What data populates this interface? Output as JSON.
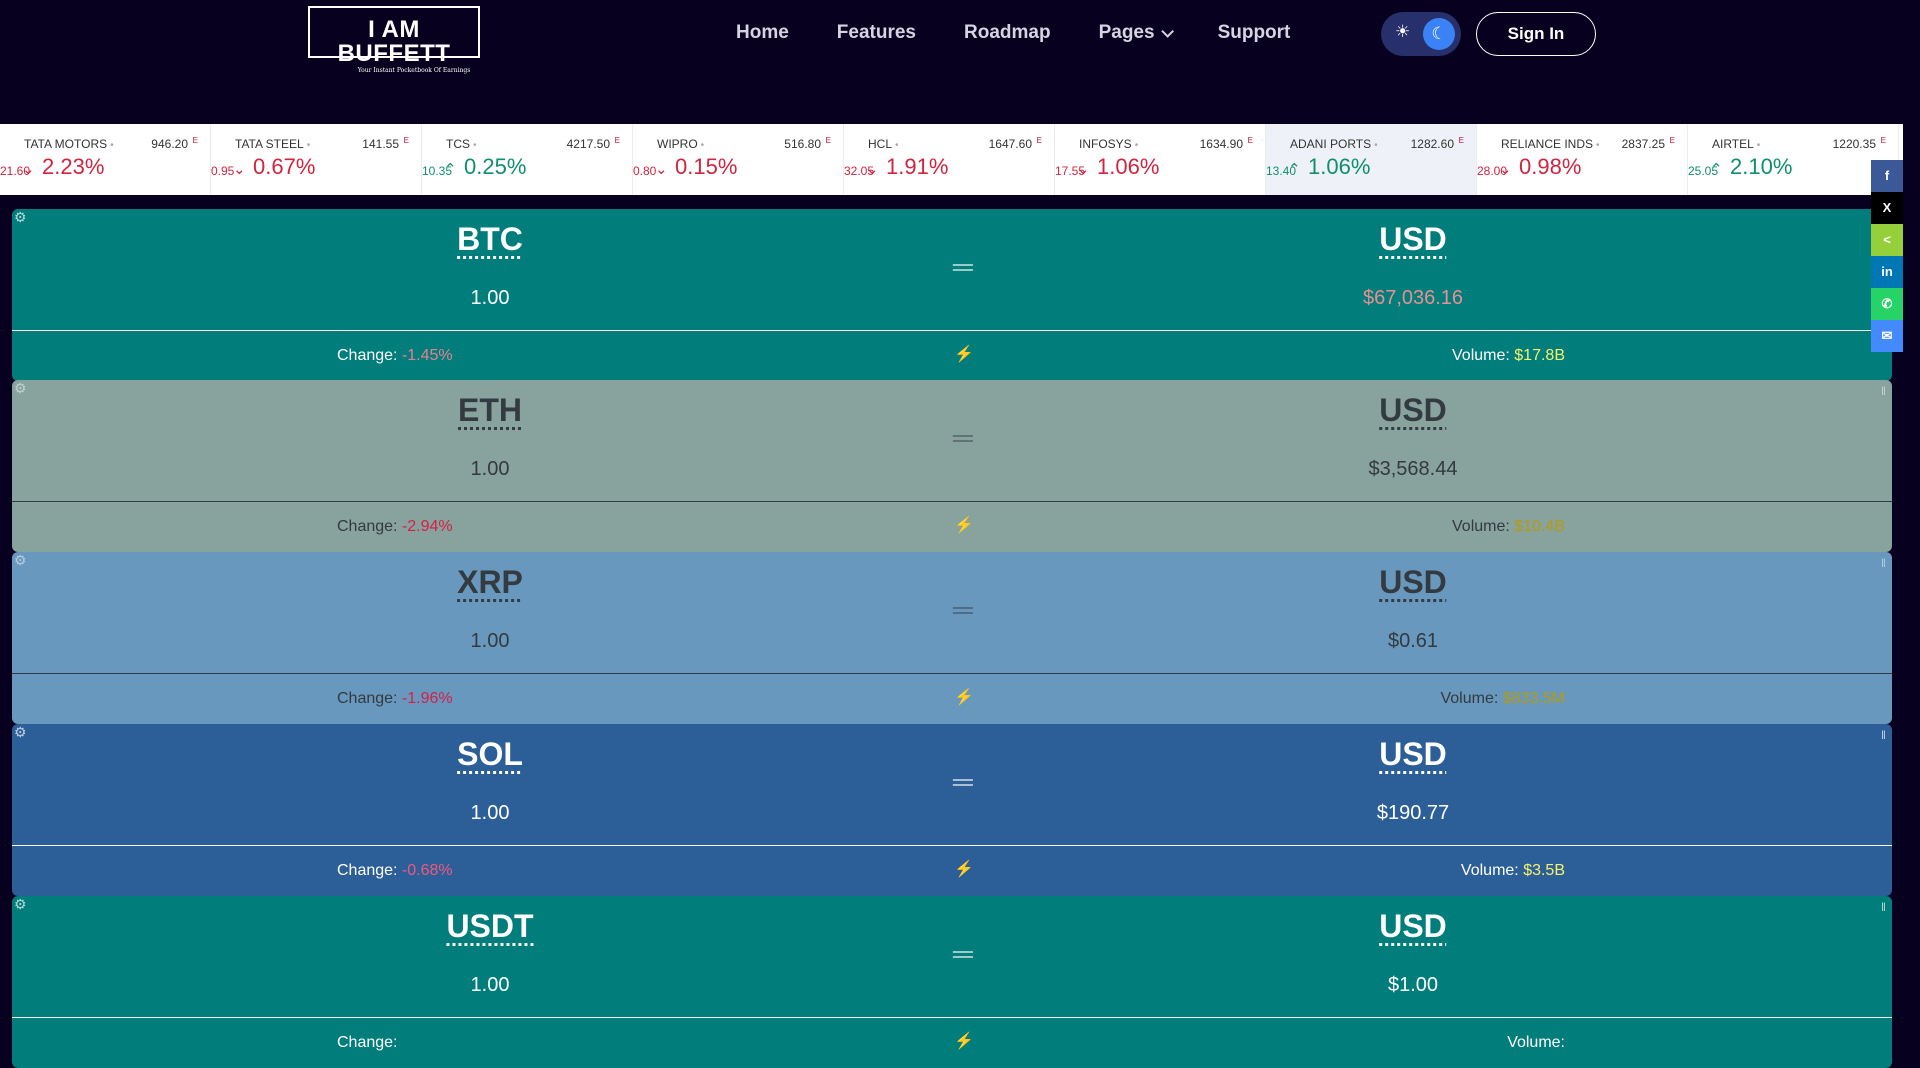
{
  "header": {
    "logo_title": "I AM BUFFETT",
    "logo_tagline": "Your Instant Pocketbook Of Earnings",
    "nav": [
      {
        "label": "Home"
      },
      {
        "label": "Features"
      },
      {
        "label": "Roadmap"
      },
      {
        "label": "Pages"
      },
      {
        "label": "Support"
      }
    ],
    "sign_in_label": "Sign In",
    "theme_sun": "☀",
    "theme_moon": "☾"
  },
  "ticker": [
    {
      "name": "TATA MOTORS",
      "price": "946.20",
      "marker": "E",
      "dir": "down",
      "arrow": "⌄",
      "pct": "2.23%",
      "chg": "21.60",
      "color": "#d0243f"
    },
    {
      "name": "TATA STEEL",
      "price": "141.55",
      "marker": "E",
      "dir": "down",
      "arrow": "⌄",
      "pct": "0.67%",
      "chg": "0.95",
      "color": "#d0243f"
    },
    {
      "name": "TCS",
      "price": "4217.50",
      "marker": "E",
      "dir": "up",
      "arrow": "⌃",
      "pct": "0.25%",
      "chg": "10.35",
      "color": "#0f8f6f"
    },
    {
      "name": "WIPRO",
      "price": "516.80",
      "marker": "E",
      "dir": "down",
      "arrow": "⌄",
      "pct": "0.15%",
      "chg": "0.80",
      "color": "#d0243f"
    },
    {
      "name": "HCL",
      "price": "1647.60",
      "marker": "E",
      "dir": "down",
      "arrow": "⌄",
      "pct": "1.91%",
      "chg": "32.05",
      "color": "#d0243f"
    },
    {
      "name": "INFOSYS",
      "price": "1634.90",
      "marker": "E",
      "dir": "down",
      "arrow": "⌄",
      "pct": "1.06%",
      "chg": "17.55",
      "color": "#d0243f"
    },
    {
      "name": "ADANI PORTS",
      "price": "1282.60",
      "marker": "E",
      "dir": "up",
      "arrow": "⌃",
      "pct": "1.06%",
      "chg": "13.40",
      "color": "#0f8f6f"
    },
    {
      "name": "RELIANCE INDS",
      "price": "2837.25",
      "marker": "E",
      "dir": "down",
      "arrow": "⌄",
      "pct": "0.98%",
      "chg": "28.00",
      "color": "#d0243f"
    },
    {
      "name": "AIRTEL",
      "price": "1220.35",
      "marker": "E",
      "dir": "up",
      "arrow": "⌃",
      "pct": "2.10%",
      "chg": "25.05",
      "color": "#0f8f6f"
    }
  ],
  "converters": [
    {
      "from": "BTC",
      "to": "USD",
      "from_amount": "1.00",
      "to_amount": "$67,036.16",
      "change_label": "Change:",
      "change": "-1.45%",
      "volume_label": "Volume:",
      "volume": "$17.8B",
      "bg": "#017d7b",
      "theme": "dark",
      "to_amount_color": "#e88f8f",
      "change_color": "#e8818d",
      "volume_color": "#f5f06a"
    },
    {
      "from": "ETH",
      "to": "USD",
      "from_amount": "1.00",
      "to_amount": "$3,568.44",
      "change_label": "Change:",
      "change": "-2.94%",
      "volume_label": "Volume:",
      "volume": "$10.4B",
      "bg": "#88a29e",
      "theme": "light",
      "to_amount_color": "#333a40",
      "change_color": "#d51f47",
      "volume_color": "#b59a12"
    },
    {
      "from": "XRP",
      "to": "USD",
      "from_amount": "1.00",
      "to_amount": "$0.61",
      "change_label": "Change:",
      "change": "-1.96%",
      "volume_label": "Volume:",
      "volume": "$833.5M",
      "bg": "#6898bd",
      "theme": "light",
      "to_amount_color": "#333a40",
      "change_color": "#d51f47",
      "volume_color": "#b59a12"
    },
    {
      "from": "SOL",
      "to": "USD",
      "from_amount": "1.00",
      "to_amount": "$190.77",
      "change_label": "Change:",
      "change": "-0.68%",
      "volume_label": "Volume:",
      "volume": "$3.5B",
      "bg": "#2c5f98",
      "theme": "dark",
      "to_amount_color": "#ffffff",
      "change_color": "#f0587c",
      "volume_color": "#f5f06a"
    },
    {
      "from": "USDT",
      "to": "USD",
      "from_amount": "1.00",
      "to_amount": "$1.00",
      "change_label": "Change:",
      "change": "",
      "volume_label": "Volume:",
      "volume": "",
      "bg": "#017d7b",
      "theme": "dark",
      "to_amount_color": "#ffffff",
      "change_color": "#e8818d",
      "volume_color": "#f5f06a"
    }
  ],
  "share": [
    {
      "name": "facebook",
      "glyph": "f",
      "color": "#3b5998"
    },
    {
      "name": "x-twitter",
      "glyph": "X",
      "color": "#000000"
    },
    {
      "name": "sharethis",
      "glyph": "<",
      "color": "#95d03a"
    },
    {
      "name": "linkedin",
      "glyph": "in",
      "color": "#0077b5"
    },
    {
      "name": "whatsapp",
      "glyph": "✆",
      "color": "#25d366"
    },
    {
      "name": "messenger",
      "glyph": "✉",
      "color": "#448aff"
    }
  ]
}
